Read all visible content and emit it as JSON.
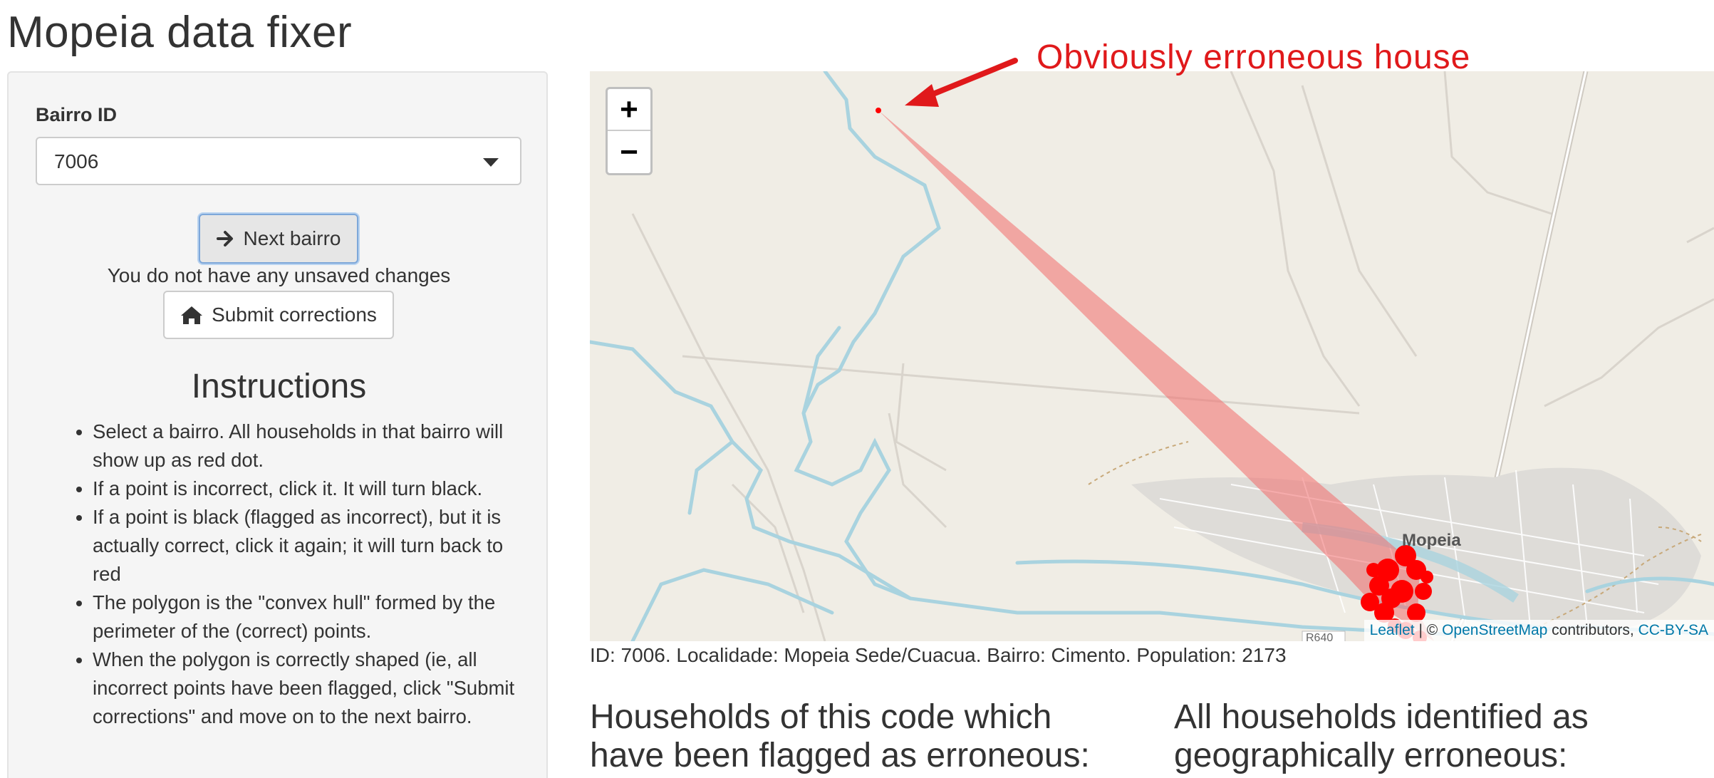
{
  "page": {
    "title": "Mopeia data fixer"
  },
  "sidebar": {
    "bairro_label": "Bairro ID",
    "bairro_select": {
      "value": "7006"
    },
    "next_button": {
      "label": "Next bairro",
      "icon": "arrow-right-icon"
    },
    "unsaved_status": "You do not have any unsaved changes",
    "submit_button": {
      "label": "Submit corrections",
      "icon": "home-icon"
    },
    "instructions": {
      "title": "Instructions",
      "items": [
        "Select a bairro. All households in that bairro will show up as red dot.",
        "If a point is incorrect, click it. It will turn black.",
        "If a point is black (flagged as incorrect), but it is actually correct, click it again; it will turn back to red",
        "The polygon is the \"convex hull\" formed by the perimeter of the (correct) points.",
        "When the polygon is correctly shaped (ie, all incorrect points have been flagged, click \"Submit corrections\" and move on to the next bairro."
      ]
    }
  },
  "map": {
    "zoom_in": "+",
    "zoom_out": "−",
    "town_label": "Mopeia",
    "road_label": "R640",
    "attribution": {
      "leaflet": "Leaflet",
      "separator": " | © ",
      "osm": "OpenStreetMap",
      "contributors": " contributors, ",
      "license": "CC-BY-SA"
    },
    "colors": {
      "land": "#f0ede5",
      "water": "#a9d3df",
      "points": "#ff0000",
      "hull": "#f26b6b"
    }
  },
  "annotation": {
    "text": "Obviously erroneous house",
    "color": "#e0191b"
  },
  "info_line": "ID: 7006. Localidade: Mopeia Sede/Cuacua. Bairro: Cimento. Population: 2173",
  "sections": {
    "flagged_title": "Households of this code which have been flagged as erroneous:",
    "all_title": "All households identified as geographically erroneous:"
  }
}
